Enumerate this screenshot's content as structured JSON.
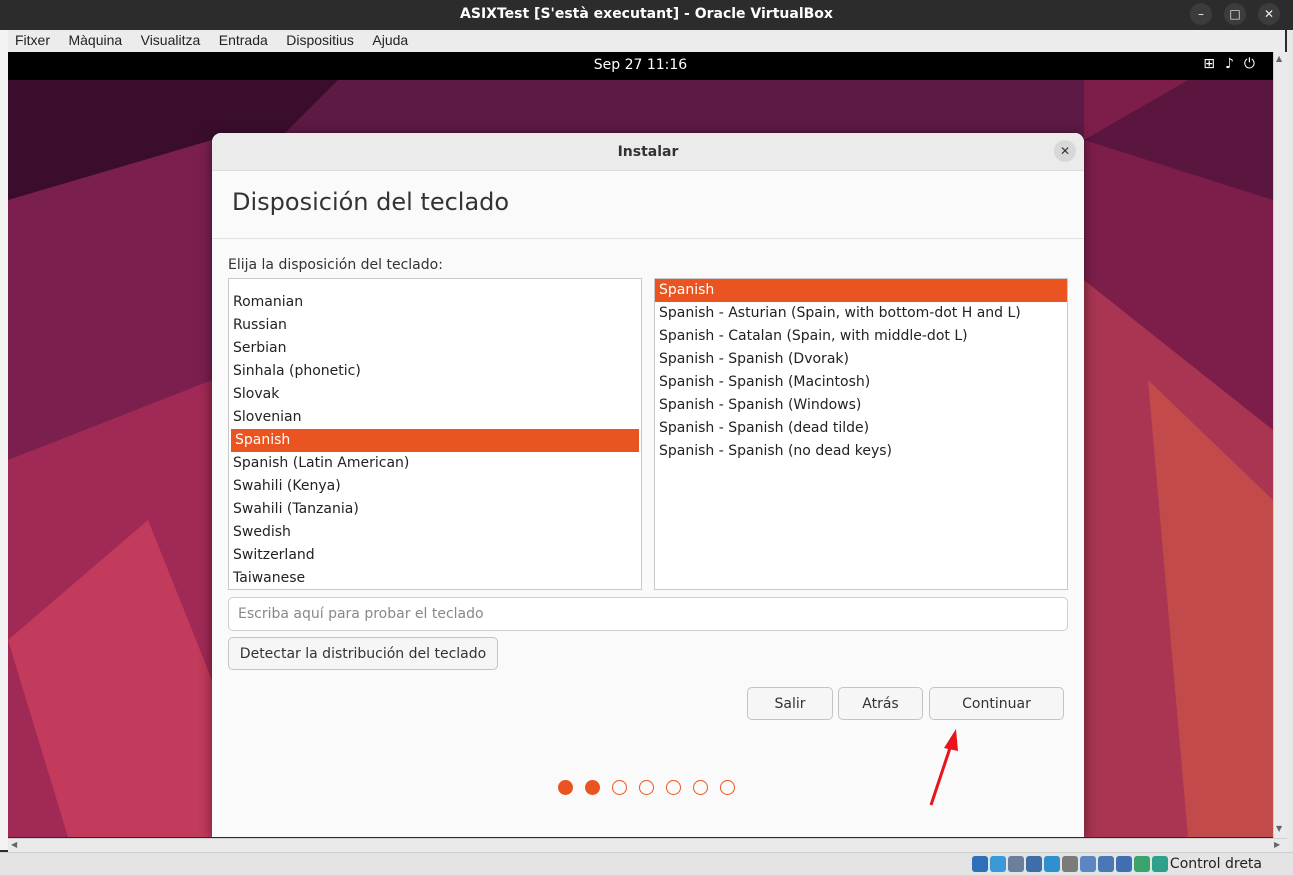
{
  "window": {
    "title": "ASIXTest [S'està executant] - Oracle VirtualBox",
    "minimize_glyph": "–",
    "maximize_glyph": "□",
    "close_glyph": "✕"
  },
  "menubar": {
    "items": [
      "Fitxer",
      "Màquina",
      "Visualitza",
      "Entrada",
      "Dispositius",
      "Ajuda"
    ]
  },
  "guest_topbar": {
    "clock": "Sep 27  11:16",
    "tray_icons": [
      "network-icon",
      "volume-icon",
      "power-icon"
    ]
  },
  "installer": {
    "window_title": "Instalar",
    "close_glyph": "✕",
    "page_title": "Disposición del teclado",
    "prompt": "Elija la disposición del teclado:",
    "layouts": [
      "Romanian",
      "Russian",
      "Serbian",
      "Sinhala (phonetic)",
      "Slovak",
      "Slovenian",
      "Spanish",
      "Spanish (Latin American)",
      "Swahili (Kenya)",
      "Swahili (Tanzania)",
      "Swedish",
      "Switzerland",
      "Taiwanese"
    ],
    "selected_layout": "Spanish",
    "variants": [
      "Spanish",
      "Spanish - Asturian (Spain, with bottom-dot H and L)",
      "Spanish - Catalan (Spain, with middle-dot L)",
      "Spanish - Spanish (Dvorak)",
      "Spanish - Spanish (Macintosh)",
      "Spanish - Spanish (Windows)",
      "Spanish - Spanish (dead tilde)",
      "Spanish - Spanish (no dead keys)"
    ],
    "selected_variant": "Spanish",
    "test_placeholder": "Escriba aquí para probar el teclado",
    "detect_label": "Detectar la distribución del teclado",
    "quit_label": "Salir",
    "back_label": "Atrás",
    "continue_label": "Continuar",
    "progress": {
      "total_steps": 7,
      "completed_steps": 2
    }
  },
  "statusbar": {
    "host_key": "Control dreta"
  },
  "colors": {
    "accent": "#e95420",
    "annotation_arrow": "#e8141c"
  }
}
